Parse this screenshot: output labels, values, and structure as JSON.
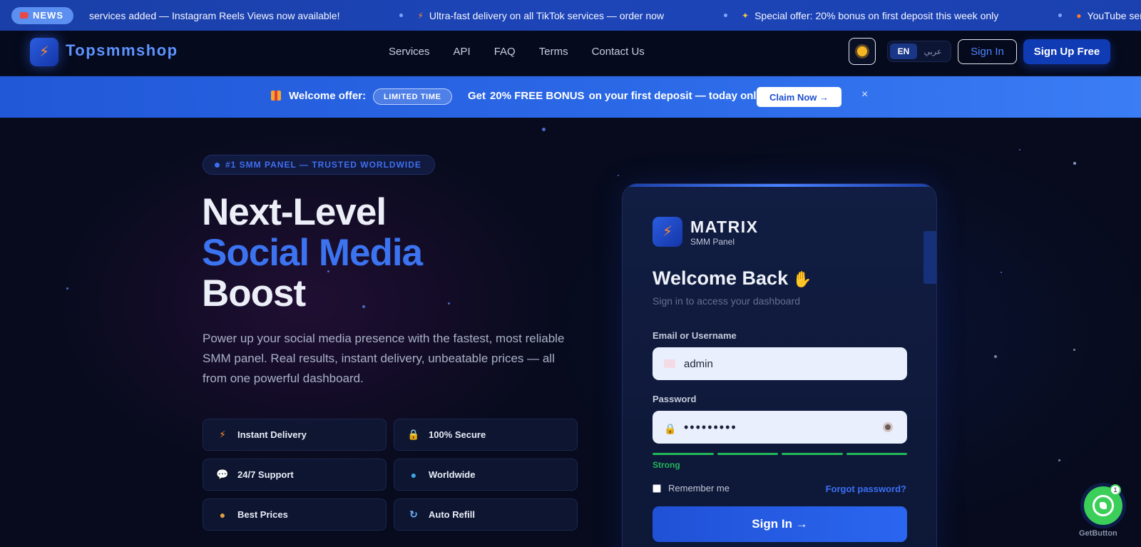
{
  "ticker": {
    "badge": "NEWS",
    "items": [
      "services added — Instagram Reels Views now available!",
      "Ultra-fast delivery on all TikTok services — order now",
      "Special offer: 20% bonus on first deposit this week only",
      "YouTube services"
    ]
  },
  "nav": {
    "brand": "Topsmmshop",
    "links": [
      "Services",
      "API",
      "FAQ",
      "Terms",
      "Contact Us"
    ],
    "lang_en": "EN",
    "lang_ar": "عربي",
    "signin": "Sign In",
    "signup": "Sign Up Free"
  },
  "promo": {
    "lead": "Welcome offer:",
    "pill": "LIMITED TIME",
    "text_before": "Get",
    "highlight": "20% FREE BONUS",
    "text_after": "on your first deposit — today only!",
    "cta": "Claim Now →",
    "close": "×"
  },
  "hero": {
    "badge": "#1 SMM PANEL — TRUSTED WORLDWIDE",
    "title_line1": "Next-Level",
    "title_line2": "Social Media",
    "title_line3": "Boost",
    "description": "Power up your social media presence with the fastest, most reliable SMM panel. Real results, instant delivery, unbeatable prices — all from one powerful dashboard.",
    "features": [
      "Instant Delivery",
      "100% Secure",
      "24/7 Support",
      "Worldwide",
      "Best Prices",
      "Auto Refill"
    ]
  },
  "login": {
    "brand": "MATRIX",
    "brand_sub": "SMM Panel",
    "title": "Welcome Back",
    "subtitle": "Sign in to access your dashboard",
    "email_label": "Email or Username",
    "email_value": "admin",
    "password_label": "Password",
    "password_value": "•••••••••",
    "strength": "Strong",
    "remember": "Remember me",
    "forgot": "Forgot password?",
    "submit": "Sign In →"
  },
  "widget": {
    "label": "GetButton",
    "badge": "1"
  },
  "colors": {
    "accent": "#3b73f0",
    "ticker_bg": "#1d45b8",
    "promo_bg": "#2c6ae8",
    "page_bg": "#070b1d",
    "success": "#22b657",
    "whatsapp": "#3bcf5a"
  }
}
